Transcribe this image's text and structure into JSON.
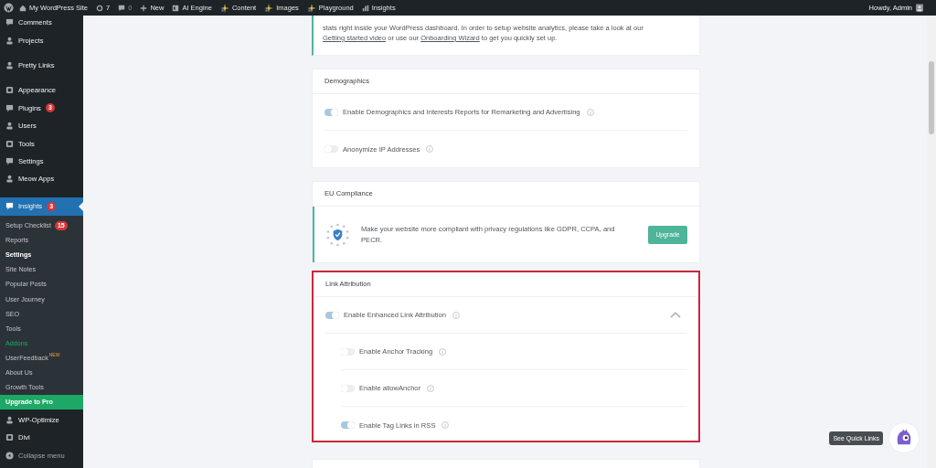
{
  "admin_bar": {
    "items": [
      {
        "label": "My WordPress Site"
      },
      {
        "label": "7"
      },
      {
        "label": "0"
      },
      {
        "label": "New"
      },
      {
        "label": "AI Engine"
      },
      {
        "label": "Content"
      },
      {
        "label": "Images"
      },
      {
        "label": "Playground"
      },
      {
        "label": "Insights"
      }
    ],
    "account": "Howdy, Admin"
  },
  "sidebar": {
    "groups": [
      [
        {
          "label": "Comments",
          "selected": false,
          "kind": "menu"
        },
        {
          "label": "Projects",
          "selected": false,
          "kind": "menu"
        }
      ],
      [
        {
          "label": "Pretty Links",
          "selected": false,
          "kind": "menu"
        }
      ],
      [
        {
          "label": "Appearance",
          "selected": false,
          "kind": "menu"
        },
        {
          "label": "Plugins",
          "badge": "3",
          "selected": false,
          "kind": "menu"
        },
        {
          "label": "Users",
          "selected": false,
          "kind": "menu"
        },
        {
          "label": "Tools",
          "selected": false,
          "kind": "menu"
        },
        {
          "label": "Settings",
          "selected": false,
          "kind": "menu"
        },
        {
          "label": "Meow Apps",
          "selected": false,
          "kind": "menu"
        }
      ],
      [
        {
          "label": "Insights",
          "badge": "3",
          "selected": true,
          "kind": "menu",
          "children": [
            {
              "label": "Setup Checklist",
              "badge": "15",
              "selected": false,
              "kind": "link"
            },
            {
              "label": "Reports",
              "selected": false,
              "kind": "link"
            },
            {
              "label": "Settings",
              "selected": true,
              "kind": "link"
            },
            {
              "label": "Site Notes",
              "selected": false,
              "kind": "link"
            },
            {
              "label": "Popular Posts",
              "selected": false,
              "kind": "link"
            },
            {
              "label": "User Journey",
              "selected": false,
              "kind": "link"
            },
            {
              "label": "SEO",
              "selected": false,
              "kind": "link"
            },
            {
              "label": "Tools",
              "selected": false,
              "kind": "link"
            },
            {
              "label": "Addons",
              "selected": false,
              "kind": "accent"
            },
            {
              "label": "UserFeedback",
              "tag": "NEW",
              "selected": false,
              "kind": "link"
            },
            {
              "label": "About Us",
              "selected": false,
              "kind": "link"
            },
            {
              "label": "Growth Tools",
              "selected": false,
              "kind": "link"
            },
            {
              "label": "Upgrade to Pro",
              "selected": false,
              "kind": "upgrade"
            }
          ]
        },
        {
          "label": "WP-Optimize",
          "selected": false,
          "kind": "menu"
        },
        {
          "label": "Divi",
          "selected": false,
          "kind": "menu"
        },
        {
          "label": "Collapse menu",
          "selected": false,
          "kind": "collapse"
        }
      ]
    ]
  },
  "intro": {
    "text": "stats right inside your WordPress dashboard. In order to setup website analytics, please take a look at our",
    "link_1": "Getting started video",
    "middle": "or use our",
    "link_2": "Onboarding Wizard",
    "end": "to get you quickly set up."
  },
  "demographics": {
    "title": "Demographics",
    "options": [
      {
        "label": "Enable Demographics and Interests Reports for Remarketing and Advertising",
        "on": true
      },
      {
        "label": "Anonymize IP Addresses",
        "on": false
      }
    ]
  },
  "eu_compliance": {
    "title": "EU Compliance",
    "text": "Make your website more compliant with privacy regulations like GDPR, CCPA, and PECR.",
    "button": "Upgrade"
  },
  "link_attribution": {
    "title": "Link Attribution",
    "highlighted": true,
    "option": {
      "label": "Enable Enhanced Link Attribution",
      "on": true,
      "expanded": true
    },
    "sub_options": [
      {
        "label": "Enable Anchor Tracking",
        "on": false
      },
      {
        "label": "Enable allowAnchor",
        "on": false
      },
      {
        "label": "Enable Tag Links in RSS",
        "on": true
      }
    ]
  },
  "quick_links": {
    "tooltip": "See Quick Links"
  }
}
